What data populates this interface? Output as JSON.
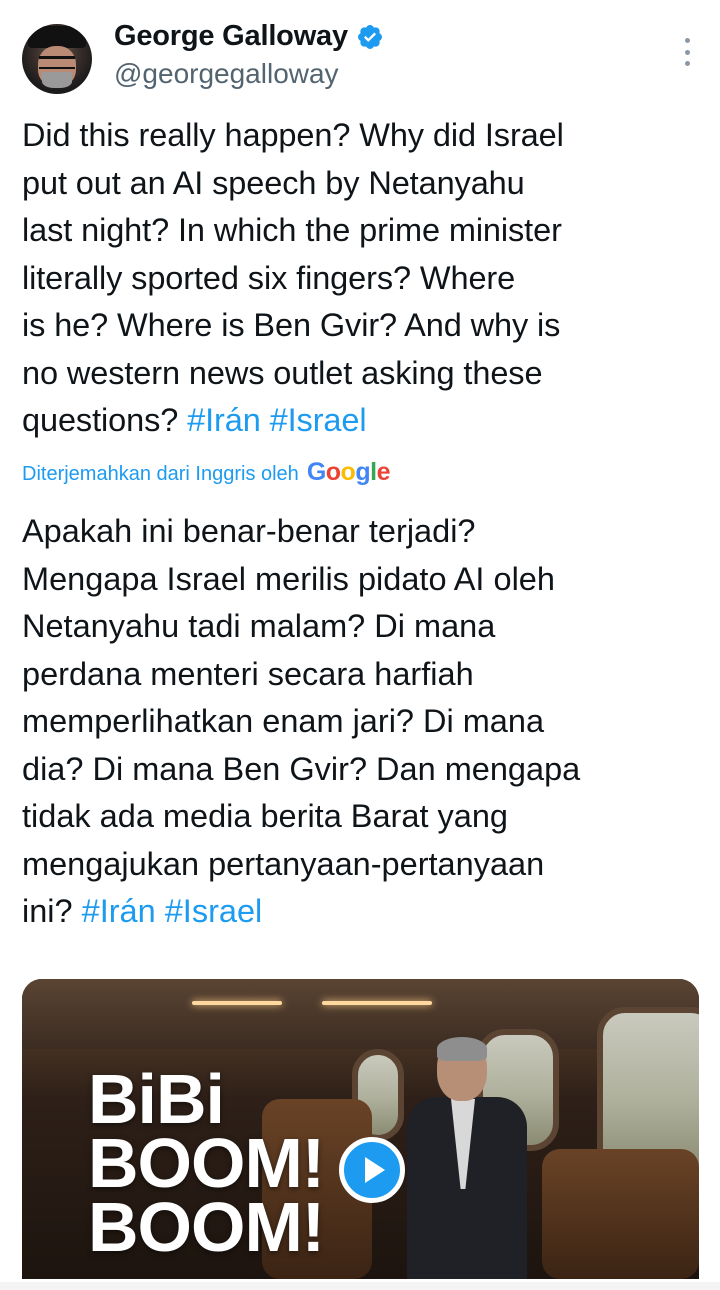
{
  "author": {
    "name": "George Galloway",
    "handle": "@georgegalloway"
  },
  "tweet": {
    "text": "Did this really happen? Why did Israel\nput out an AI speech by Netanyahu\nlast night? In which the prime minister\nliterally sported six fingers? Where\nis he? Where is Ben Gvir? And why is\nno western news outlet asking these\nquestions? ",
    "hashtags": [
      "#Irán",
      "#Israel"
    ]
  },
  "translation_note": {
    "label": "Diterjemahkan dari Inggris oleh",
    "provider": "Google"
  },
  "translation": {
    "text": "Apakah ini benar-benar terjadi?\nMengapa Israel merilis pidato AI oleh\nNetanyahu tadi malam? Di mana\nperdana menteri secara harfiah\nmemperlihatkan enam jari? Di mana\ndia? Di mana Ben Gvir? Dan mengapa\ntidak ada media berita Barat yang\nmengajukan pertanyaan-pertanyaan\nini? ",
    "hashtags": [
      "#Irán",
      "#Israel"
    ]
  },
  "media": {
    "overlay_lines": [
      "BiBi",
      "BOOM!",
      "BOOM!"
    ],
    "play_icon": "play-icon"
  },
  "colors": {
    "accent": "#1d9bf0",
    "text": "#0f1419",
    "muted": "#536471"
  }
}
